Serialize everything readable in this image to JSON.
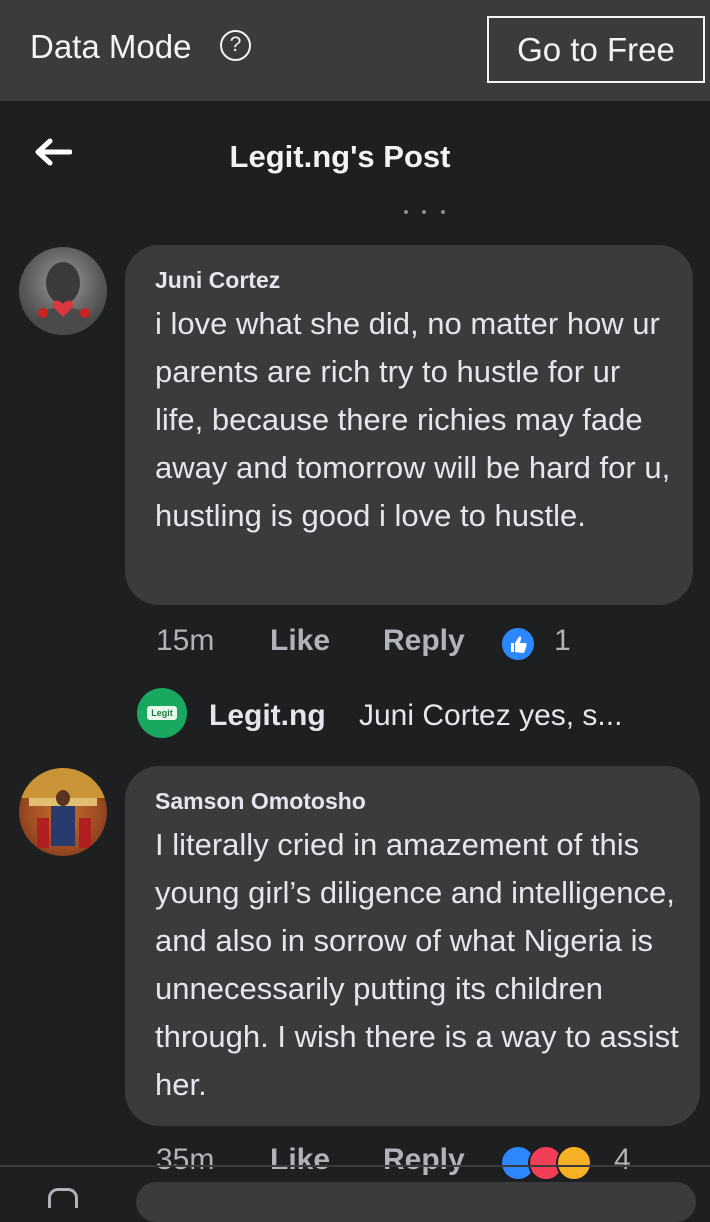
{
  "topbar": {
    "data_mode_label": "Data Mode",
    "info_icon": "info-icon",
    "go_to_free_label": "Go to Free"
  },
  "header": {
    "back_icon": "arrow-left-icon",
    "title": "Legit.ng's Post"
  },
  "comments": [
    {
      "author": "Juni Cortez",
      "text": "i love what she did, no matter how ur parents are rich try to hustle for ur life, because there richies may fade away and tomorrow will be hard for u, hustling is good i love to hustle.",
      "time": "15m",
      "like_label": "Like",
      "reply_label": "Reply",
      "reaction_count": "1"
    },
    {
      "author": "Samson Omotosho",
      "text": "I literally cried in amazement of this young girl’s diligence and intelligence, and also in sorrow of what Nigeria is unnecessarily putting its children through. I wish there is a way to assist her.",
      "time": "35m",
      "like_label": "Like",
      "reply_label": "Reply",
      "reaction_count": "4"
    }
  ],
  "reply_preview": {
    "logo_text": "Legit",
    "name": "Legit.ng",
    "snippet": "Juni Cortez yes, s..."
  },
  "colors": {
    "background": "#1e1f21",
    "bubble": "#3a3b3d",
    "like_blue": "#2d88ff",
    "secondary_text": "#b0b3b8"
  }
}
